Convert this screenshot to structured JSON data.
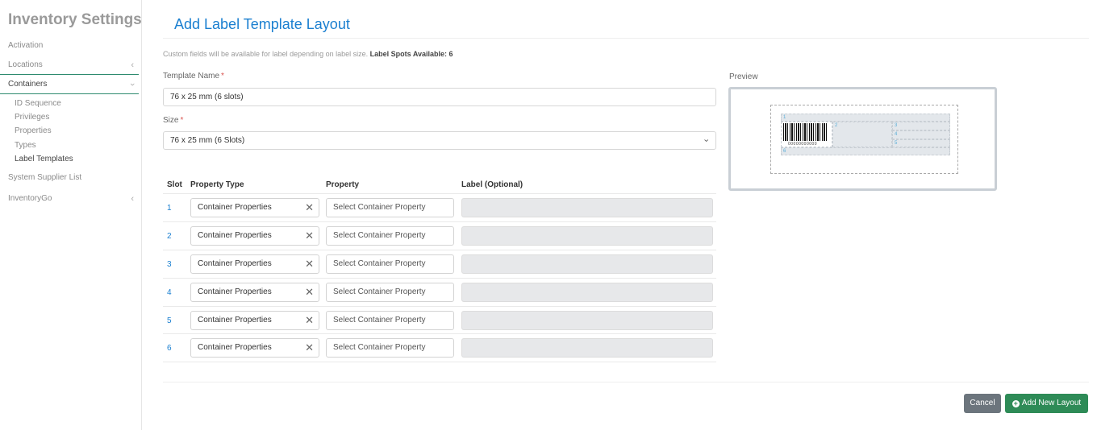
{
  "sidebar": {
    "title": "Inventory Settings",
    "items": [
      {
        "label": "Activation"
      },
      {
        "label": "Locations"
      },
      {
        "label": "Containers"
      },
      {
        "label": "System Supplier List"
      },
      {
        "label": "InventoryGo"
      }
    ],
    "container_subitems": [
      {
        "label": "ID Sequence"
      },
      {
        "label": "Privileges"
      },
      {
        "label": "Properties"
      },
      {
        "label": "Types"
      },
      {
        "label": "Label Templates"
      }
    ]
  },
  "main": {
    "title": "Add Label Template Layout",
    "info_text": "Custom fields will be available for label depending on label size.",
    "info_spots_label": "Label Spots Available: 6",
    "template_name_label": "Template Name",
    "required_mark": "*",
    "template_name_value": "76 x 25 mm (6 slots)",
    "size_label": "Size",
    "size_value": "76 x 25 mm (6 Slots)",
    "preview_label": "Preview"
  },
  "table": {
    "headers": {
      "slot": "Slot",
      "property_type": "Property Type",
      "property": "Property",
      "label": "Label (Optional)"
    },
    "rows": [
      {
        "slot": "1",
        "property_type": "Container Properties",
        "property_placeholder": "Select Container Property",
        "label": ""
      },
      {
        "slot": "2",
        "property_type": "Container Properties",
        "property_placeholder": "Select Container Property",
        "label": ""
      },
      {
        "slot": "3",
        "property_type": "Container Properties",
        "property_placeholder": "Select Container Property",
        "label": ""
      },
      {
        "slot": "4",
        "property_type": "Container Properties",
        "property_placeholder": "Select Container Property",
        "label": ""
      },
      {
        "slot": "5",
        "property_type": "Container Properties",
        "property_placeholder": "Select Container Property",
        "label": ""
      },
      {
        "slot": "6",
        "property_type": "Container Properties",
        "property_placeholder": "Select Container Property",
        "label": ""
      }
    ]
  },
  "preview": {
    "slot_labels": [
      "1",
      "2",
      "3",
      "4",
      "5",
      "6"
    ],
    "barcode_text": "00000000000"
  },
  "buttons": {
    "cancel": "Cancel",
    "add": "Add New Layout"
  },
  "icons": {
    "clear": "close-icon",
    "chevron": "chevron-icon",
    "plus": "plus-circle-icon"
  },
  "colors": {
    "accent": "#1a7fd0",
    "success": "#2e8b57",
    "secondary": "#6c757d",
    "required": "#d9534f"
  }
}
